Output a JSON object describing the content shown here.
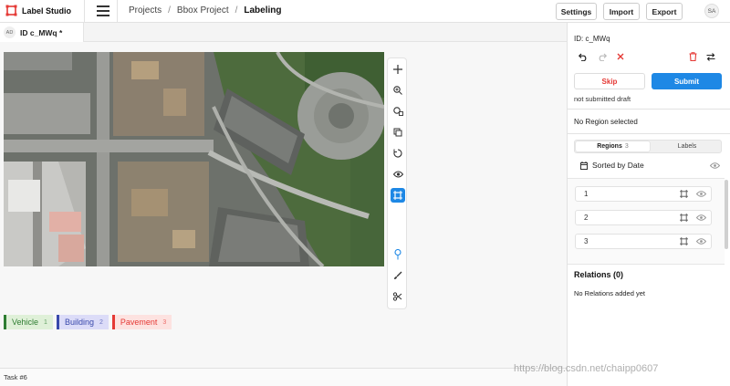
{
  "app": {
    "name": "Label Studio"
  },
  "breadcrumb": {
    "projects": "Projects",
    "sep1": "/",
    "project": "Bbox Project",
    "sep2": "/",
    "current": "Labeling"
  },
  "header": {
    "settings": "Settings",
    "import": "Import",
    "export": "Export",
    "avatar": "SA"
  },
  "tab": {
    "avatar": "AD",
    "title": "ID c_MWq *"
  },
  "tools": [
    "move-tool-icon",
    "zoom-in-icon",
    "zoom-to-fit-icon",
    "copy-icon",
    "rotate-icon",
    "eye-icon",
    "rectangle-tool-icon",
    "keypoint-icon",
    "brush-icon",
    "scissors-icon"
  ],
  "labels": [
    {
      "name": "Vehicle",
      "hotkey": "1",
      "color": "#2e7d32",
      "bg": "#dff0d8"
    },
    {
      "name": "Building",
      "hotkey": "2",
      "color": "#3949ab",
      "bg": "#dcdcf8"
    },
    {
      "name": "Pavement",
      "hotkey": "3",
      "color": "#e53935",
      "bg": "#fde2e0"
    }
  ],
  "status": {
    "task": "Task #6"
  },
  "sidebar": {
    "id": "ID: c_MWq",
    "skip": "Skip",
    "submit": "Submit",
    "draft": "not submitted draft",
    "no_region": "No Region selected",
    "tabs": {
      "regions": "Regions",
      "regions_count": "3",
      "labels": "Labels"
    },
    "sort": "Sorted by Date",
    "regions": [
      {
        "num": "1"
      },
      {
        "num": "2"
      },
      {
        "num": "3"
      }
    ],
    "relations_title": "Relations (0)",
    "relations_empty": "No Relations added yet"
  },
  "watermark": "https://blog.csdn.net/chaipp0607",
  "colors": {
    "accent": "#1e88e5",
    "danger": "#e53935"
  }
}
